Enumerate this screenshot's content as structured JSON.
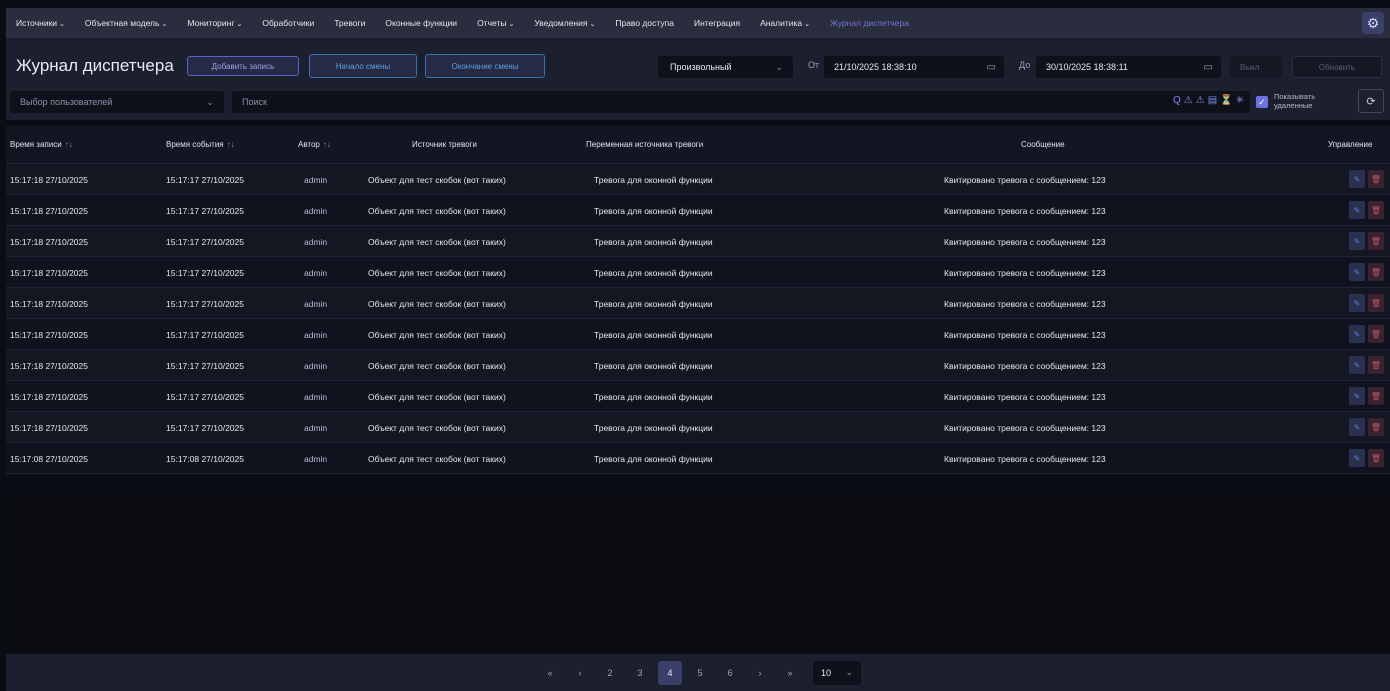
{
  "nav": {
    "items": [
      {
        "label": "Источники",
        "dropdown": true
      },
      {
        "label": "Объектная модель",
        "dropdown": true
      },
      {
        "label": "Мониторинг",
        "dropdown": true
      },
      {
        "label": "Обработчики",
        "dropdown": false
      },
      {
        "label": "Тревоги",
        "dropdown": false
      },
      {
        "label": "Оконные функции",
        "dropdown": false
      },
      {
        "label": "Отчеты",
        "dropdown": true
      },
      {
        "label": "Уведомления",
        "dropdown": true
      },
      {
        "label": "Право доступа",
        "dropdown": false
      },
      {
        "label": "Интеграция",
        "dropdown": false
      },
      {
        "label": "Аналитика",
        "dropdown": true
      },
      {
        "label": "Журнал диспетчера",
        "dropdown": false,
        "active": true
      }
    ],
    "chevron": "⌄",
    "settings_icon": "⚙"
  },
  "header": {
    "title": "Журнал диспетчера",
    "add_record": "Добавить запись",
    "shift_start": "Начало смены",
    "shift_end": "Окончание смены",
    "range_select": "Произвольный",
    "from_label": "От",
    "from_value": "21/10/2025 18:38:10",
    "to_label": "До",
    "to_value": "30/10/2025 18:38:11",
    "extra_select": "Выкл",
    "update_button": "Обновить"
  },
  "filters": {
    "user_select_placeholder": "Выбор пользователей",
    "search_placeholder": "Поиск",
    "show_deleted": "Показывать удаленные",
    "search_icons": [
      "Q",
      "⚠",
      "⚠",
      "▤",
      "⏳",
      "✳"
    ]
  },
  "table": {
    "headers": {
      "record_time": "Время записи",
      "event_time": "Время события",
      "author": "Автор",
      "source": "Источник тревоги",
      "variable": "Переменная источника тревоги",
      "message": "Сообщение",
      "control": "Управление"
    },
    "sort_icon": "↑↓",
    "rows": [
      {
        "record_time": "15:17:18 27/10/2025",
        "event_time": "15:17:17 27/10/2025",
        "author": "admin",
        "source": "Объект для тест скобок (вот таких)",
        "variable": "Тревога для оконной функции",
        "message": "Квитировано тревога с сообщением: 123"
      },
      {
        "record_time": "15:17:18 27/10/2025",
        "event_time": "15:17:17 27/10/2025",
        "author": "admin",
        "source": "Объект для тест скобок (вот таких)",
        "variable": "Тревога для оконной функции",
        "message": "Квитировано тревога с сообщением: 123"
      },
      {
        "record_time": "15:17:18 27/10/2025",
        "event_time": "15:17:17 27/10/2025",
        "author": "admin",
        "source": "Объект для тест скобок (вот таких)",
        "variable": "Тревога для оконной функции",
        "message": "Квитировано тревога с сообщением: 123"
      },
      {
        "record_time": "15:17:18 27/10/2025",
        "event_time": "15:17:17 27/10/2025",
        "author": "admin",
        "source": "Объект для тест скобок (вот таких)",
        "variable": "Тревога для оконной функции",
        "message": "Квитировано тревога с сообщением: 123"
      },
      {
        "record_time": "15:17:18 27/10/2025",
        "event_time": "15:17:17 27/10/2025",
        "author": "admin",
        "source": "Объект для тест скобок (вот таких)",
        "variable": "Тревога для оконной функции",
        "message": "Квитировано тревога с сообщением: 123"
      },
      {
        "record_time": "15:17:18 27/10/2025",
        "event_time": "15:17:17 27/10/2025",
        "author": "admin",
        "source": "Объект для тест скобок (вот таких)",
        "variable": "Тревога для оконной функции",
        "message": "Квитировано тревога с сообщением: 123"
      },
      {
        "record_time": "15:17:18 27/10/2025",
        "event_time": "15:17:17 27/10/2025",
        "author": "admin",
        "source": "Объект для тест скобок (вот таких)",
        "variable": "Тревога для оконной функции",
        "message": "Квитировано тревога с сообщением: 123"
      },
      {
        "record_time": "15:17:18 27/10/2025",
        "event_time": "15:17:17 27/10/2025",
        "author": "admin",
        "source": "Объект для тест скобок (вот таких)",
        "variable": "Тревога для оконной функции",
        "message": "Квитировано тревога с сообщением: 123"
      },
      {
        "record_time": "15:17:18 27/10/2025",
        "event_time": "15:17:17 27/10/2025",
        "author": "admin",
        "source": "Объект для тест скобок (вот таких)",
        "variable": "Тревога для оконной функции",
        "message": "Квитировано тревога с сообщением: 123"
      },
      {
        "record_time": "15:17:08 27/10/2025",
        "event_time": "15:17:08 27/10/2025",
        "author": "admin",
        "source": "Объект для тест скобок (вот таких)",
        "variable": "Тревога для оконной функции",
        "message": "Квитировано тревога с сообщением: 123"
      }
    ]
  },
  "pagination": {
    "first": "«",
    "prev": "‹",
    "pages": [
      "2",
      "3",
      "4",
      "5",
      "6"
    ],
    "active_page": "4",
    "next": "›",
    "last": "»",
    "per_page": "10"
  }
}
